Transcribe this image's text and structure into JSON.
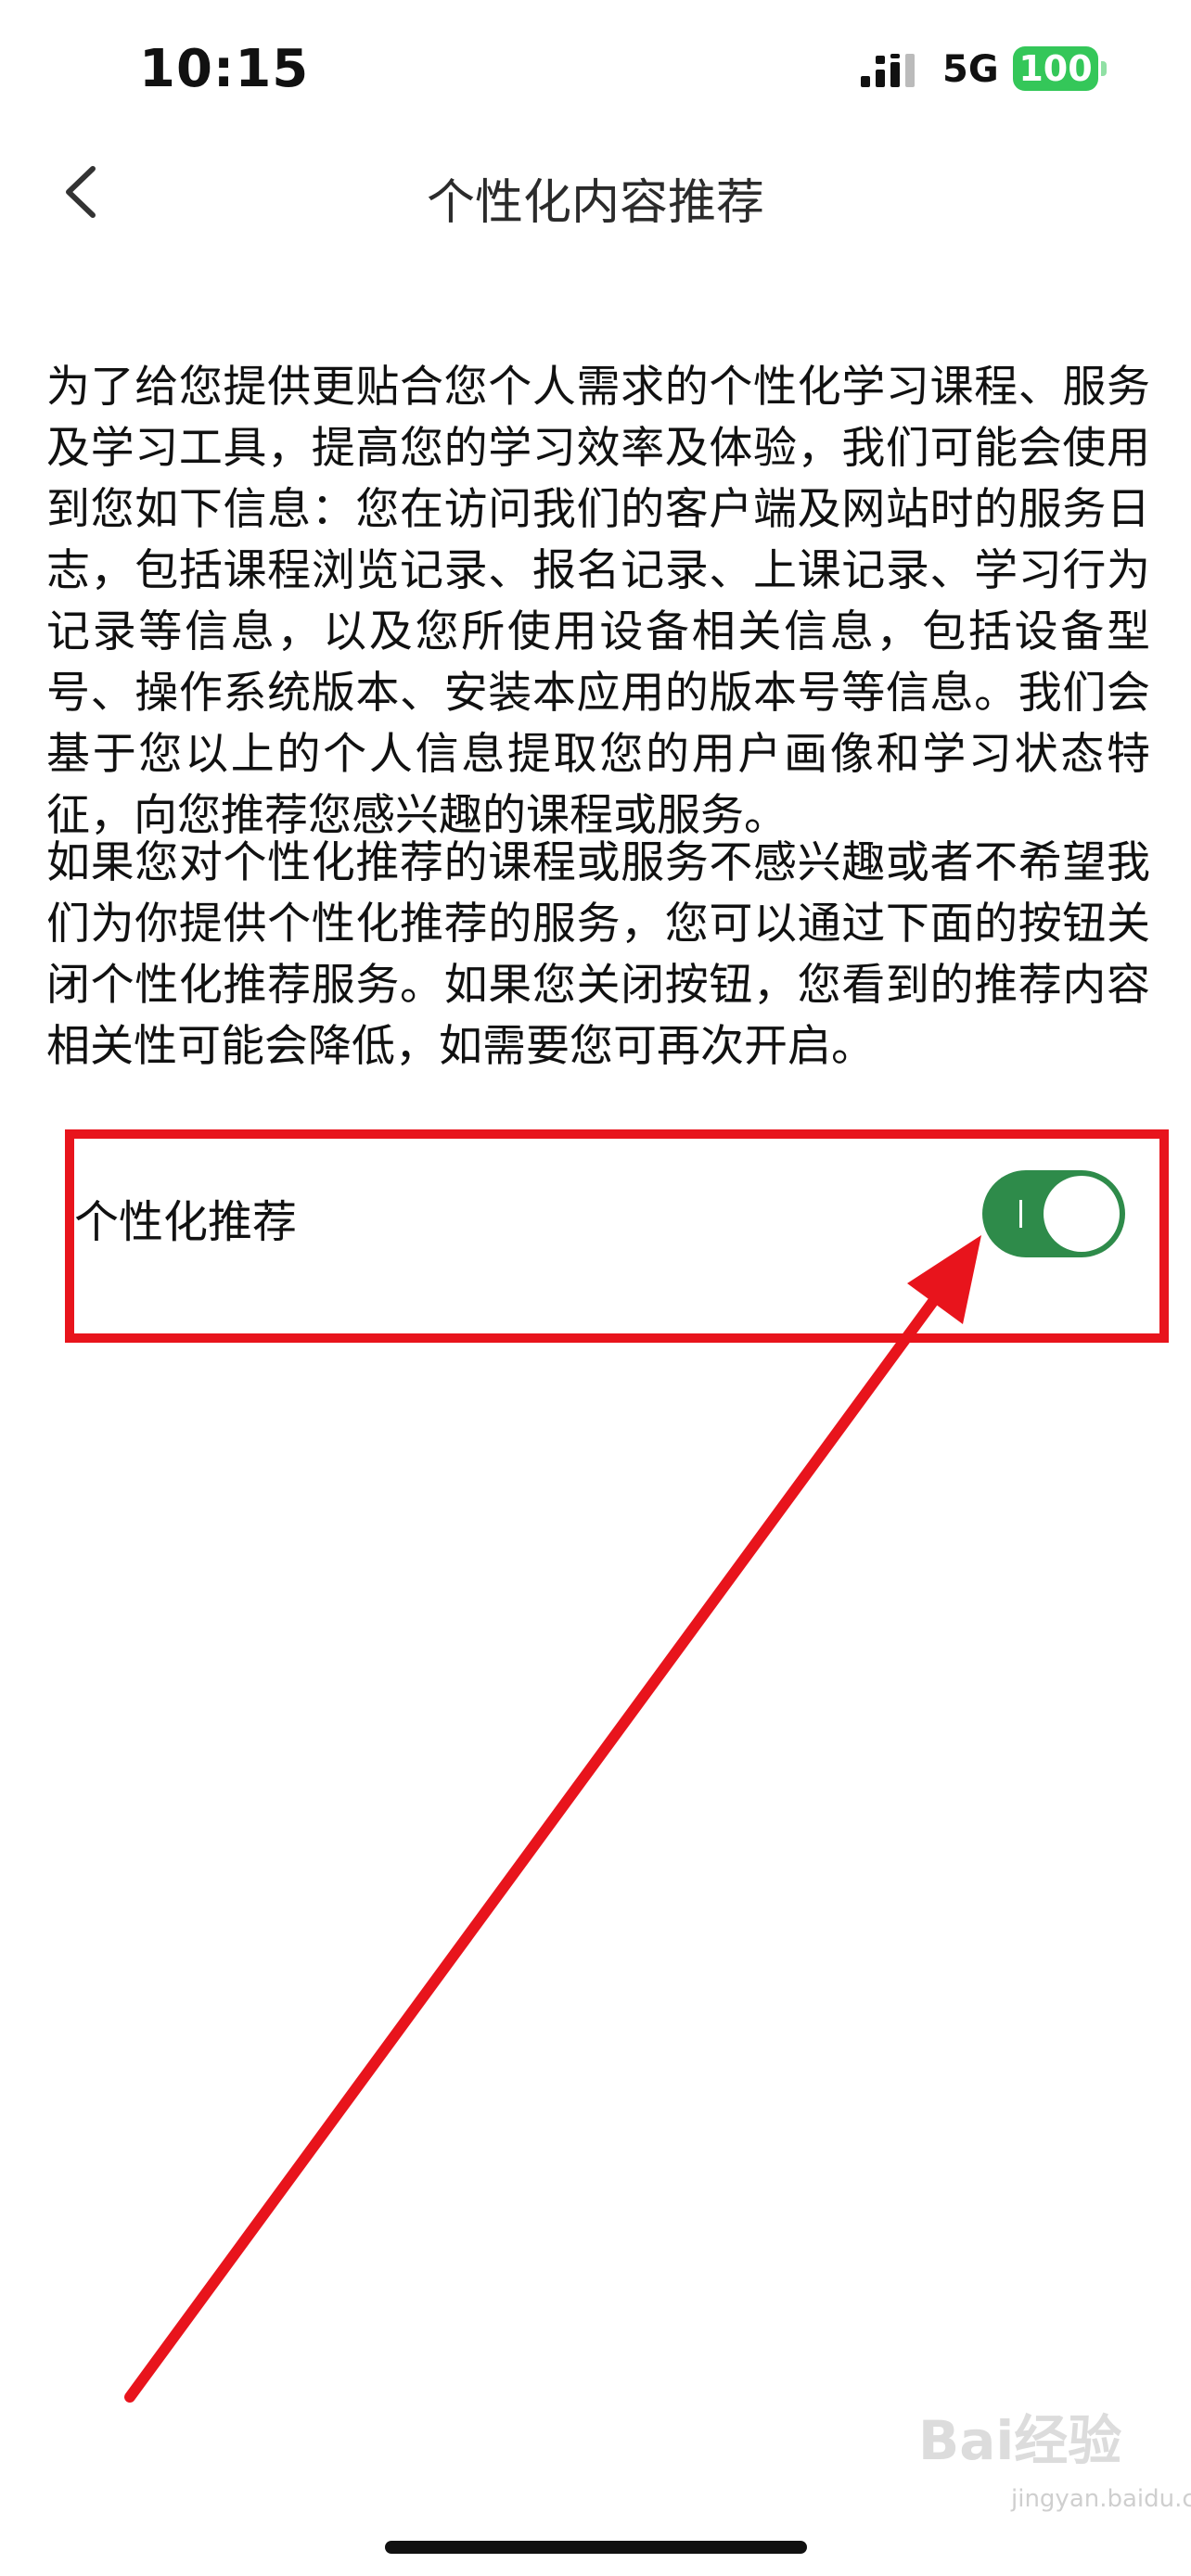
{
  "status_bar": {
    "time": "10:15",
    "network": "5G",
    "battery": "100"
  },
  "nav": {
    "title": "个性化内容推荐",
    "back_icon": "chevron-left-icon"
  },
  "content": {
    "paragraph1": "为了给您提供更贴合您个人需求的个性化学习课程、服务及学习工具，提高您的学习效率及体验，我们可能会使用到您如下信息：您在访问我们的客户端及网站时的服务日志，包括课程浏览记录、报名记录、上课记录、学习行为记录等信息，以及您所使用设备相关信息，包括设备型号、操作系统版本、安装本应用的版本号等信息。我们会基于您以上的个人信息提取您的用户画像和学习状态特征，向您推荐您感兴趣的课程或服务。",
    "paragraph2": "如果您对个性化推荐的课程或服务不感兴趣或者不希望我们为你提供个性化推荐的服务，您可以通过下面的按钮关闭个性化推荐服务。如果您关闭按钮，您看到的推荐内容相关性可能会降低，如需要您可再次开启。"
  },
  "setting": {
    "label": "个性化推荐",
    "enabled": true,
    "toggle_color": "#2e8b4a"
  },
  "annotation": {
    "color": "#e8141c"
  },
  "watermark": {
    "brand": "Bai经验",
    "url": "jingyan.baidu.com"
  }
}
